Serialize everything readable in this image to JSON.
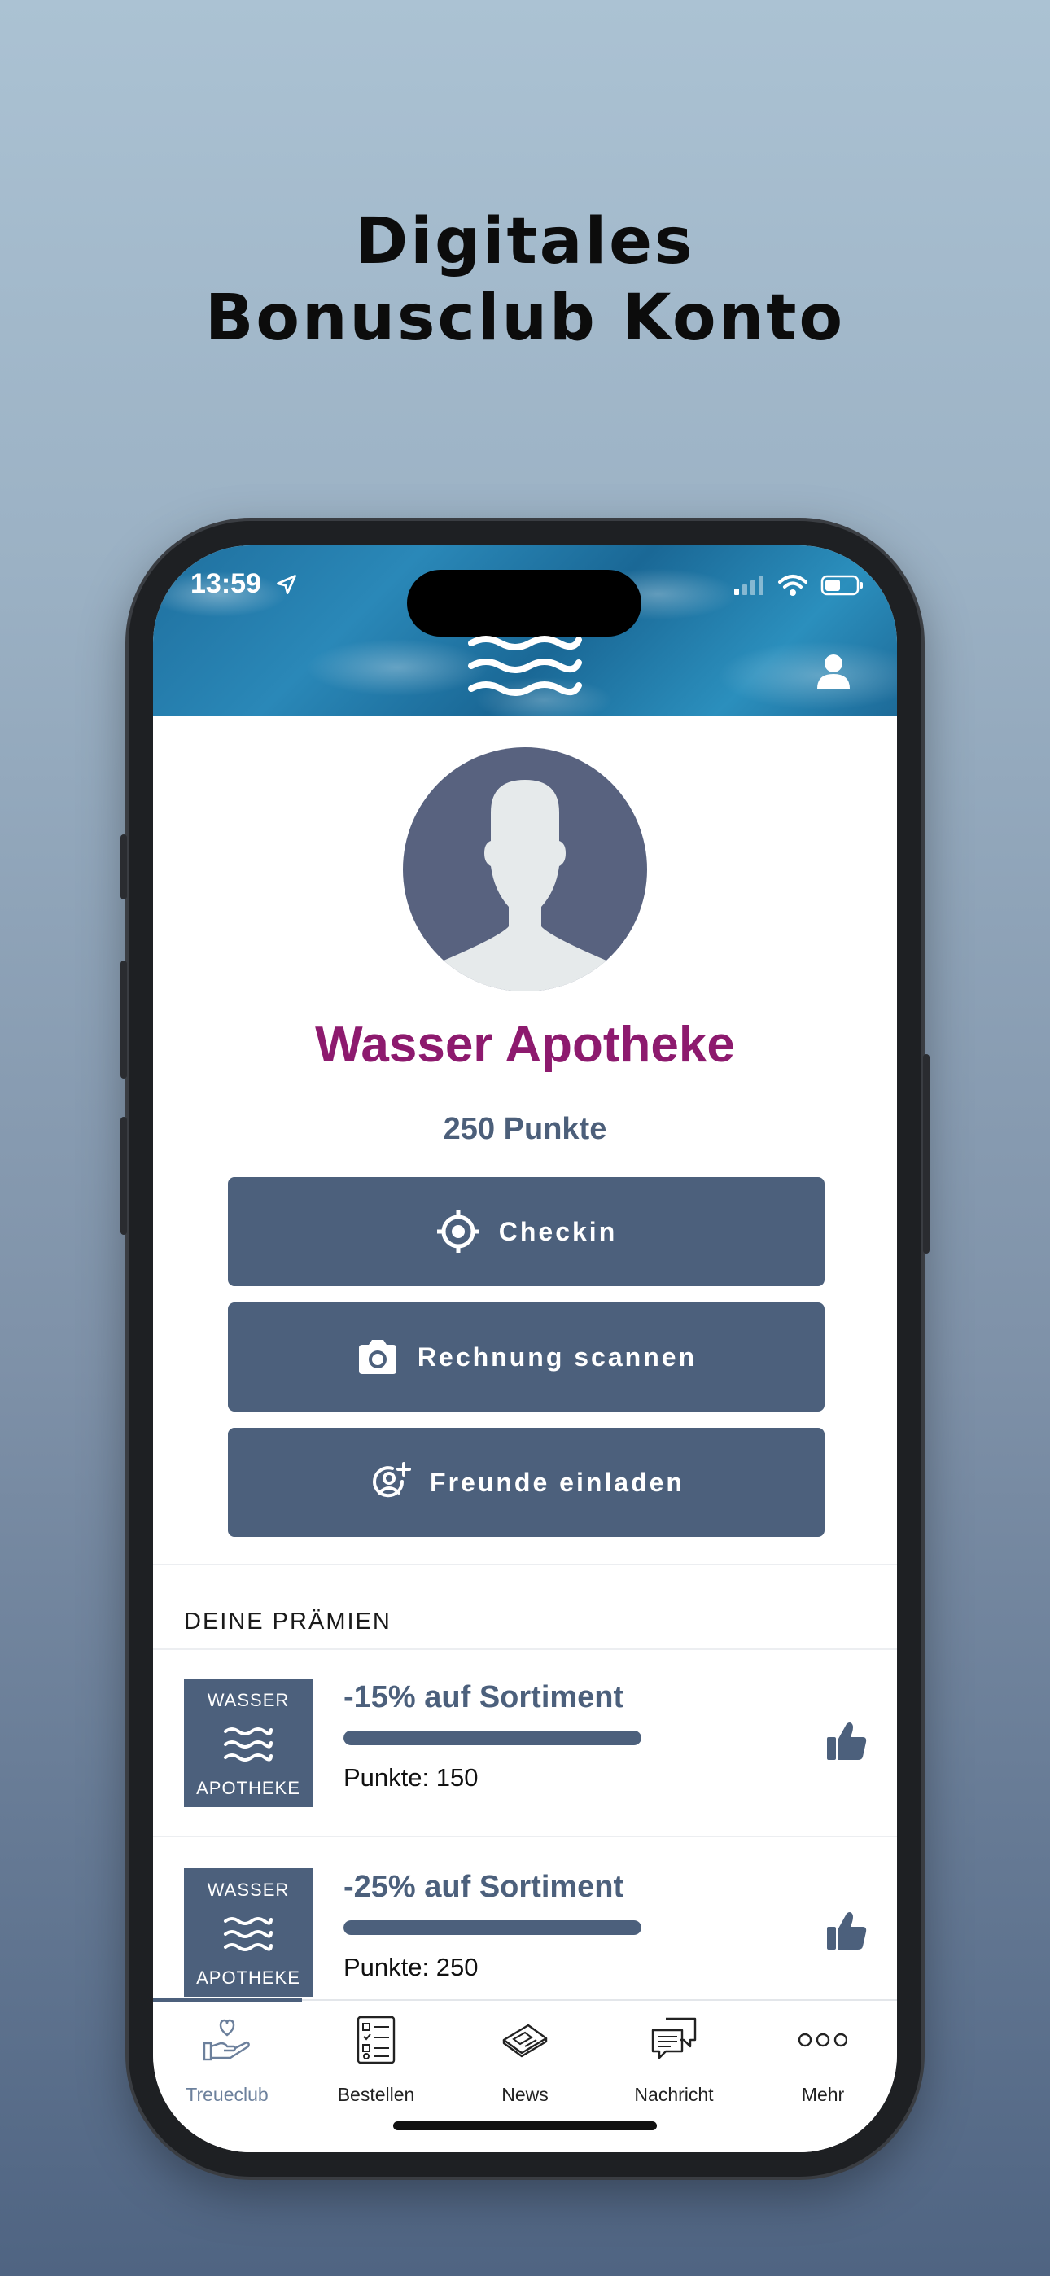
{
  "headline": {
    "line1": "Digitales",
    "line2": "Bonusclub Konto"
  },
  "status_bar": {
    "time": "13:59"
  },
  "profile": {
    "name": "Wasser Apotheke",
    "points": "250 Punkte"
  },
  "actions": [
    {
      "label": "Checkin",
      "icon": "crosshair-icon"
    },
    {
      "label": "Rechnung scannen",
      "icon": "camera-icon"
    },
    {
      "label": "Freunde einladen",
      "icon": "add-user-icon"
    }
  ],
  "rewards_section": {
    "title": "DEINE PRÄMIEN"
  },
  "rewards": [
    {
      "logo_top": "WASSER",
      "logo_bottom": "APOTHEKE",
      "title": "-15% auf Sortiment",
      "points": "Punkte: 150",
      "progress": 1.0
    },
    {
      "logo_top": "WASSER",
      "logo_bottom": "APOTHEKE",
      "title": "-25% auf Sortiment",
      "points": "Punkte: 250",
      "progress": 1.0
    }
  ],
  "tabs": [
    {
      "label": "Treueclub",
      "icon": "hand-heart-icon",
      "active": true
    },
    {
      "label": "Bestellen",
      "icon": "checklist-icon",
      "active": false
    },
    {
      "label": "News",
      "icon": "newspaper-icon",
      "active": false
    },
    {
      "label": "Nachricht",
      "icon": "chat-bubbles-icon",
      "active": false
    },
    {
      "label": "Mehr",
      "icon": "more-dots-icon",
      "active": false
    }
  ],
  "colors": {
    "brand": "#8d1a6e",
    "primary": "#4c607c",
    "active_tab": "#6c809c"
  }
}
